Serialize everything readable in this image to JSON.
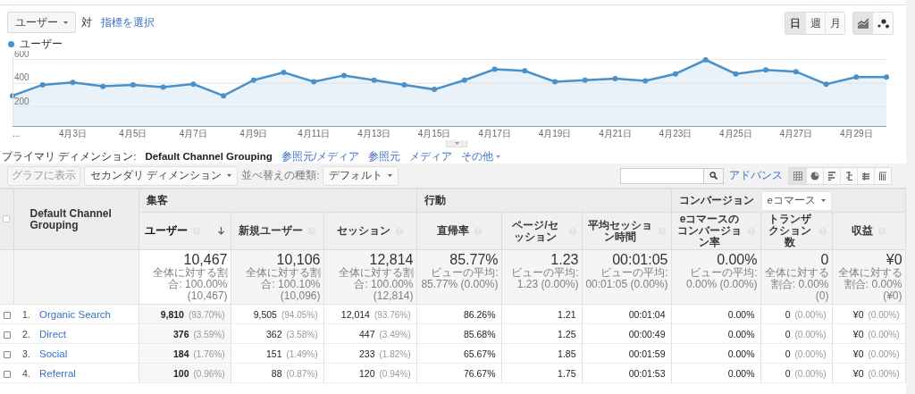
{
  "metric_picker": {
    "value": "ユーザー",
    "versus": "対",
    "link": "指標を選択"
  },
  "interval_buttons": [
    {
      "label": "日",
      "selected": true
    },
    {
      "label": "週",
      "selected": false
    },
    {
      "label": "月",
      "selected": false
    }
  ],
  "chart_modes": [
    {
      "kind": "line",
      "selected": true
    },
    {
      "kind": "motion",
      "selected": false
    }
  ],
  "chart_data": {
    "type": "area",
    "categories": [
      "...",
      null,
      "4月3日",
      null,
      "4月5日",
      null,
      "4月7日",
      null,
      "4月9日",
      null,
      "4月11日",
      null,
      "4月13日",
      null,
      "4月15日",
      null,
      "4月17日",
      null,
      "4月19日",
      null,
      "4月21日",
      null,
      "4月23日",
      null,
      "4月25日",
      null,
      "4月27日",
      null,
      "4月29日",
      null
    ],
    "series": [
      {
        "name": "ユーザー",
        "color": "#4a90c9",
        "values": [
          295,
          387,
          407,
          374,
          387,
          367,
          393,
          295,
          426,
          492,
          413,
          466,
          426,
          387,
          348,
          426,
          518,
          505,
          413,
          426,
          439,
          420,
          479,
          597,
          479,
          512,
          498,
          393,
          452,
          452
        ]
      }
    ],
    "ylim": [
      40,
      650
    ],
    "yticks": [
      200,
      400,
      600
    ],
    "grid": true
  },
  "primary_dimension": {
    "label": "プライマリ ディメンション:",
    "options": [
      {
        "label": "Default Channel Grouping",
        "selected": true,
        "kind": "option"
      },
      {
        "label": "参照元/メディア",
        "selected": false,
        "kind": "option"
      },
      {
        "label": "参照元",
        "selected": false,
        "kind": "option"
      },
      {
        "label": "メディア",
        "selected": false,
        "kind": "option"
      },
      {
        "label": "その他",
        "selected": false,
        "kind": "menu"
      }
    ]
  },
  "toolbar": {
    "plot_button": {
      "label": "グラフに表示",
      "disabled": true
    },
    "secondary_dimension": "セカンダリ ディメンション",
    "sort_label": "並べ替えの種類:",
    "sort_value": "デフォルト",
    "advanced_link": "アドバンス",
    "views": [
      {
        "kind": "grid",
        "selected": true
      },
      {
        "kind": "pie",
        "selected": false
      },
      {
        "kind": "bars",
        "selected": false
      },
      {
        "kind": "compare",
        "selected": false
      },
      {
        "kind": "pivot",
        "selected": false
      },
      {
        "kind": "columns",
        "selected": false
      }
    ]
  },
  "table": {
    "select_all": {
      "checked": false
    },
    "dimension_header": "Default Channel Grouping",
    "groups": [
      {
        "label": "集客",
        "columns": [
          {
            "label": "ユーザー",
            "sorted": true
          },
          {
            "label": "新規ユーザー",
            "sorted": false
          },
          {
            "label": "セッション",
            "sorted": false
          }
        ]
      },
      {
        "label": "行動",
        "columns": [
          {
            "label": "直帰率",
            "sorted": false
          },
          {
            "label": "ページ/セッション",
            "sorted": false
          },
          {
            "label": "平均セッション時間",
            "sorted": false
          }
        ]
      },
      {
        "label": "コンバージョン",
        "dropdown": "eコマース",
        "columns": [
          {
            "label": "eコマースのコンバージョン率",
            "sorted": false
          },
          {
            "label": "トランザクション数",
            "sorted": false
          },
          {
            "label": "収益",
            "sorted": false
          }
        ]
      }
    ],
    "totals": [
      {
        "value": "10,467",
        "note": "全体に対する割合: 100.00% (10,467)"
      },
      {
        "value": "10,106",
        "note": "全体に対する割合: 100.10% (10,096)"
      },
      {
        "value": "12,814",
        "note": "全体に対する割合: 100.00% (12,814)"
      },
      {
        "value": "85.77%",
        "note": "ビューの平均: 85.77% (0.00%)"
      },
      {
        "value": "1.23",
        "note": "ビューの平均: 1.23 (0.00%)"
      },
      {
        "value": "00:01:05",
        "note": "ビューの平均: 00:01:05 (0.00%)"
      },
      {
        "value": "0.00%",
        "note": "ビューの平均: 0.00% (0.00%)"
      },
      {
        "value": "0",
        "note": "全体に対する割合: 0.00% (0)"
      },
      {
        "value": "¥0",
        "note": "全体に対する割合: 0.00% (¥0)"
      }
    ],
    "rows": [
      {
        "index": "1.",
        "name": "Organic Search",
        "checked": false,
        "cells": [
          {
            "value": "9,810",
            "share": "(93.70%)"
          },
          {
            "value": "9,505",
            "share": "(94.05%)"
          },
          {
            "value": "12,014",
            "share": "(93.76%)"
          },
          {
            "value": "86.26%"
          },
          {
            "value": "1.21"
          },
          {
            "value": "00:01:04"
          },
          {
            "value": "0.00%"
          },
          {
            "value": "0",
            "share": "(0.00%)"
          },
          {
            "value": "¥0",
            "share": "(0.00%)"
          }
        ]
      },
      {
        "index": "2.",
        "name": "Direct",
        "checked": false,
        "cells": [
          {
            "value": "376",
            "share": "(3.59%)"
          },
          {
            "value": "362",
            "share": "(3.58%)"
          },
          {
            "value": "447",
            "share": "(3.49%)"
          },
          {
            "value": "85.68%"
          },
          {
            "value": "1.25"
          },
          {
            "value": "00:00:49"
          },
          {
            "value": "0.00%"
          },
          {
            "value": "0",
            "share": "(0.00%)"
          },
          {
            "value": "¥0",
            "share": "(0.00%)"
          }
        ]
      },
      {
        "index": "3.",
        "name": "Social",
        "checked": false,
        "cells": [
          {
            "value": "184",
            "share": "(1.76%)"
          },
          {
            "value": "151",
            "share": "(1.49%)"
          },
          {
            "value": "233",
            "share": "(1.82%)"
          },
          {
            "value": "65.67%"
          },
          {
            "value": "1.85"
          },
          {
            "value": "00:01:59"
          },
          {
            "value": "0.00%"
          },
          {
            "value": "0",
            "share": "(0.00%)"
          },
          {
            "value": "¥0",
            "share": "(0.00%)"
          }
        ]
      },
      {
        "index": "4.",
        "name": "Referral",
        "checked": false,
        "cells": [
          {
            "value": "100",
            "share": "(0.96%)"
          },
          {
            "value": "88",
            "share": "(0.87%)"
          },
          {
            "value": "120",
            "share": "(0.94%)"
          },
          {
            "value": "76.67%"
          },
          {
            "value": "1.75"
          },
          {
            "value": "00:01:53"
          },
          {
            "value": "0.00%"
          },
          {
            "value": "0",
            "share": "(0.00%)"
          },
          {
            "value": "¥0",
            "share": "(0.00%)"
          }
        ]
      }
    ]
  }
}
